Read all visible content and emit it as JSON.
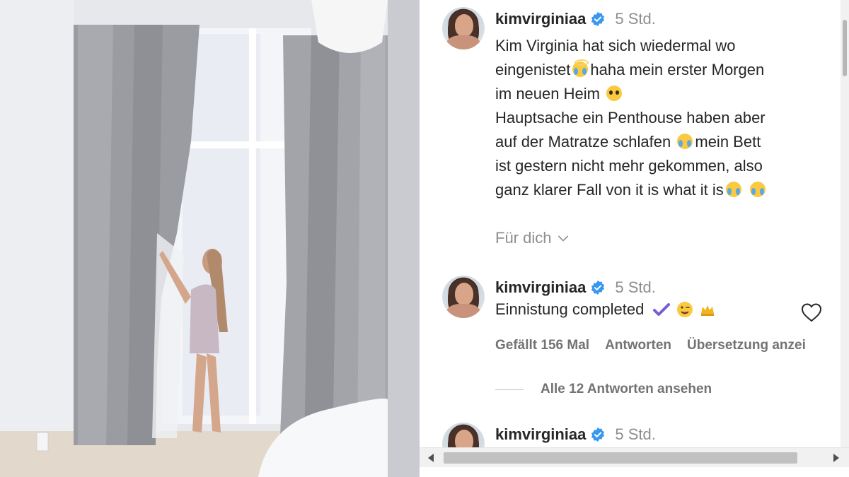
{
  "post": {
    "username": "kimvirginiaa",
    "time": "5 Std.",
    "caption_lines": [
      "Kim Virginia hat sich wiedermal wo",
      "eingenistet",
      "haha mein erster Morgen",
      "im neuen Heim",
      "Hauptsache ein Penthouse haben aber",
      "auf der Matratze schlafen",
      "mein Bett",
      "ist gestern nicht mehr gekommen, also",
      "ganz klarer Fall von it is what it is"
    ],
    "fuer_dich": "Für dich"
  },
  "comment": {
    "username": "kimvirginiaa",
    "time": "5 Std.",
    "text": "Einnistung completed",
    "likes": "Gefällt 156 Mal",
    "reply": "Antworten",
    "translate": "Übersetzung anzei",
    "view_replies": "Alle 12 Antworten ansehen"
  },
  "comment2": {
    "username": "kimvirginiaa",
    "time": "5 Std."
  },
  "colors": {
    "verified": "#3897f0",
    "check": "#7a5cd6",
    "muted": "#8e8e8e"
  },
  "icons": [
    "verified-badge-icon",
    "chevron-down-icon",
    "heart-icon",
    "check-icon",
    "crown-icon"
  ]
}
